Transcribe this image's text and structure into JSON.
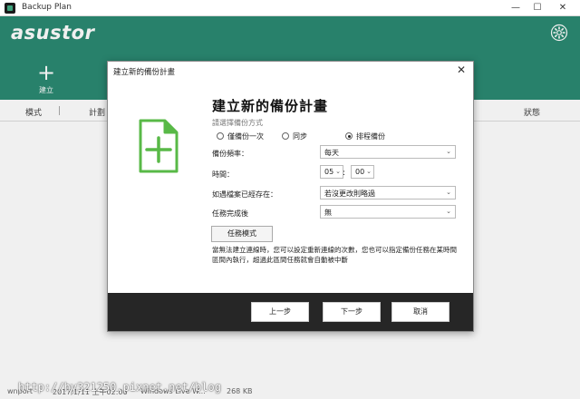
{
  "window": {
    "title": "Backup Plan",
    "minimize": "—",
    "maximize": "☐",
    "close": "✕"
  },
  "app": {
    "logo": "asustor",
    "create_label": "建立",
    "accent": "#2b8a72"
  },
  "columns": {
    "mode": "模式",
    "plan": "計劃",
    "status": "狀態"
  },
  "background_row": {
    "name": "wnport",
    "date": "2017/1/11 上午02:06",
    "target": "Windows Live W...",
    "size": "268 KB"
  },
  "dialog": {
    "title": "建立新的備份計畫",
    "close": "✕",
    "heading": "建立新的備份計畫",
    "subtitle": "請選擇備份方式",
    "radios": [
      {
        "label": "僅備份一次",
        "selected": false
      },
      {
        "label": "同步",
        "selected": false
      },
      {
        "label": "排程備份",
        "selected": true
      }
    ],
    "frequency_label": "備份頻率：",
    "frequency_value": "每天",
    "time_label": "時間：",
    "hour": "05",
    "minute": "00",
    "exists_label": "如遇檔案已經存在：",
    "exists_value": "若沒更改則略過",
    "after_label": "任務完成後",
    "after_value": "無",
    "task_mode_button": "任務模式",
    "note": "當無法建立連線時，您可以設定重新連線的次數，您也可以指定備份任務在某時間區間內執行，超過此區間任務就會自動被中斷",
    "prev_button": "上一步",
    "next_button": "下一步",
    "cancel_button": "取消"
  },
  "watermark": "http://hy321250.pixnet.net/blog"
}
